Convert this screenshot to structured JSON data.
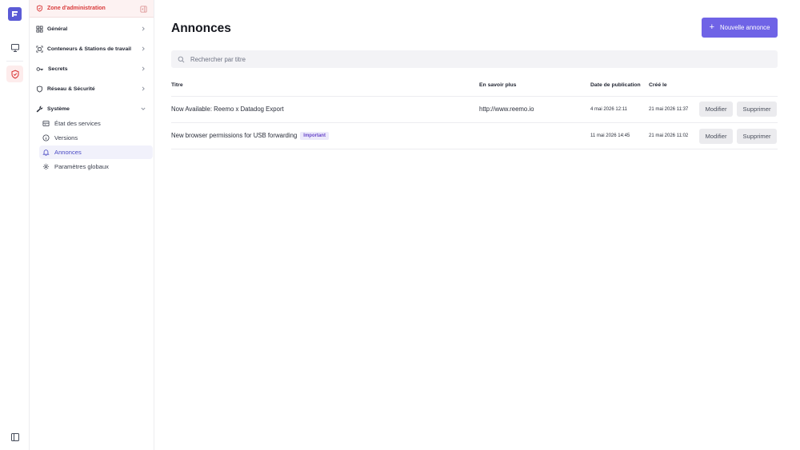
{
  "rail": {
    "icons": [
      "logo-icon",
      "monitor-icon",
      "shield-icon",
      "sidebar-toggle-icon"
    ]
  },
  "sidebar": {
    "zone_label": "Zone d'administration",
    "sections": [
      {
        "label": "Général"
      },
      {
        "label": "Conteneurs & Stations de travail"
      },
      {
        "label": "Secrets"
      },
      {
        "label": "Réseau & Sécurité"
      },
      {
        "label": "Système"
      }
    ],
    "system_items": [
      {
        "label": "État des services"
      },
      {
        "label": "Versions"
      },
      {
        "label": "Annonces"
      },
      {
        "label": "Paramètres globaux"
      }
    ]
  },
  "main": {
    "title": "Annonces",
    "new_button": "Nouvelle annonce",
    "search_placeholder": "Rechercher par titre",
    "columns": {
      "title": "Titre",
      "learn_more": "En savoir plus",
      "published": "Date de publication",
      "created": "Créé le"
    },
    "rows": [
      {
        "title": "Now Available: Reemo x Datadog Export",
        "badge": "",
        "link": "http://www.reemo.io",
        "published": "4 mai 2026 12:11",
        "created": "21 mai 2026 11:37",
        "edit": "Modifier",
        "delete": "Supprimer"
      },
      {
        "title": "New browser permissions for USB forwarding",
        "badge": "Important",
        "link": "",
        "published": "11 mai 2026 14:45",
        "created": "21 mai 2026 11:02",
        "edit": "Modifier",
        "delete": "Supprimer"
      }
    ]
  },
  "colors": {
    "accent": "#6f63e6",
    "admin_red": "#d93a3a",
    "badge_bg": "#ece9fb"
  }
}
